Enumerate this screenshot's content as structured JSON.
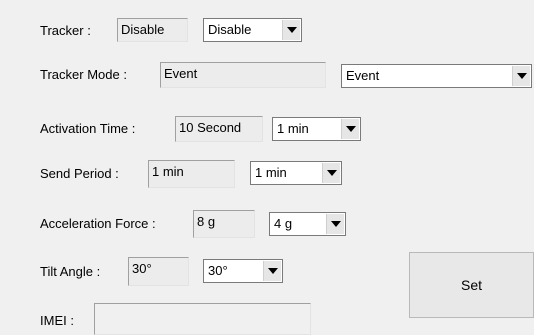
{
  "tracker": {
    "label": "Tracker :",
    "current": "Disable",
    "selected": "Disable"
  },
  "tracker_mode": {
    "label": "Tracker Mode :",
    "current": "Event",
    "selected": "Event"
  },
  "activation_time": {
    "label": "Activation Time :",
    "current": "10 Second",
    "selected": "1 min"
  },
  "send_period": {
    "label": "Send Period :",
    "current": "1 min",
    "selected": "1 min"
  },
  "acceleration_force": {
    "label": "Acceleration Force :",
    "current": "8 g",
    "selected": "4 g"
  },
  "tilt_angle": {
    "label": "Tilt Angle :",
    "current": "30°",
    "selected": "30°"
  },
  "imei": {
    "label": "IMEI :",
    "value": ""
  },
  "set_button": {
    "label": "Set"
  },
  "icons": {
    "dropdown": "chevron-down-icon"
  }
}
